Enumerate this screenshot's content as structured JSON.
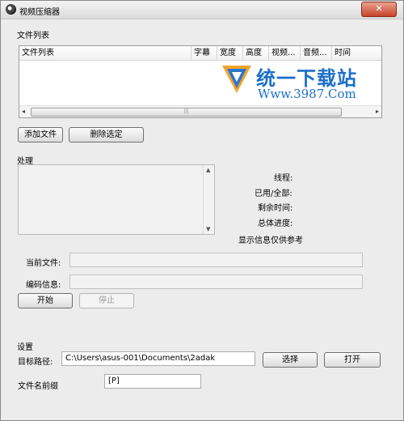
{
  "window": {
    "title": "视频压缩器",
    "close_symbol": "✕"
  },
  "file_list_group": {
    "label": "文件列表",
    "columns": [
      "文件列表",
      "字幕",
      "宽度",
      "高度",
      "视频...",
      "音频...",
      "时间"
    ],
    "scroll_left": "◂",
    "scroll_right": "▸",
    "thumb_grip": "|||"
  },
  "file_buttons": {
    "add": "添加文件",
    "delete": "删除选定"
  },
  "watermark": {
    "name": "统一下载站",
    "url": "Www.3987.Com"
  },
  "processing": {
    "label": "处理",
    "threads_label": "线程:",
    "used_total_label": "已用/全部:",
    "remaining_label": "剩余时间:",
    "progress_label": "总体进度:",
    "note": "显示信息仅供参考",
    "current_file_label": "当前文件:",
    "encode_info_label": "编码信息:",
    "current_file_value": "",
    "encode_info_value": "",
    "start_button": "开始",
    "stop_button": "停止",
    "scroll_up": "▲",
    "scroll_down": "▼"
  },
  "settings": {
    "label": "设置",
    "target_path_label": "目标路径:",
    "target_path_value": "C:\\Users\\asus-001\\Documents\\2adak",
    "select_button": "选择",
    "open_button": "打开",
    "prefix_label": "文件名前缀",
    "prefix_value": "[P]"
  }
}
